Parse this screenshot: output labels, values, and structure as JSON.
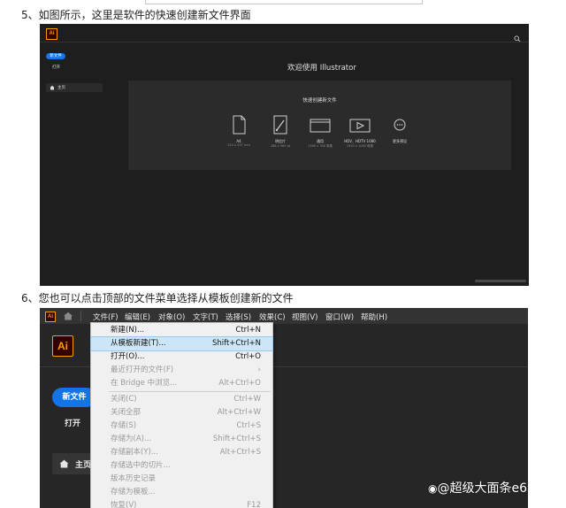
{
  "steps": {
    "step5": "5、如图所示，这里是软件的快速创建新文件界面",
    "step6": "6、您也可以点击顶部的文件菜单选择从模板创建新的文件"
  },
  "screen1": {
    "logo_text": "Ai",
    "new_file_button": "新文件",
    "open_label": "打开",
    "home_label": "主页",
    "welcome": "欢迎使用 Illustrator",
    "quick_create_title": "快速创建新文件",
    "presets": [
      {
        "name": "A4",
        "size": "210 x 297 mm",
        "icon": "document-icon"
      },
      {
        "name": "明信片",
        "size": "288 x 560 pt",
        "icon": "brush-icon"
      },
      {
        "name": "通用",
        "size": "1366 x 768 像素",
        "icon": "web-icon"
      },
      {
        "name": "HDV、HDTV 1080",
        "size": "1920 x 1080 像素",
        "icon": "video-icon"
      },
      {
        "name": "更多预设",
        "size": "",
        "icon": "more-icon"
      }
    ]
  },
  "screen2": {
    "logo_text": "Ai",
    "menubar": [
      "文件(F)",
      "编辑(E)",
      "对象(O)",
      "文字(T)",
      "选择(S)",
      "效果(C)",
      "视图(V)",
      "窗口(W)",
      "帮助(H)"
    ],
    "new_file_button": "新文件",
    "open_label": "打开",
    "home_label": "主页",
    "file_menu": [
      {
        "label": "新建(N)...",
        "shortcut": "Ctrl+N",
        "disabled": false,
        "highlight": false
      },
      {
        "label": "从模板新建(T)...",
        "shortcut": "Shift+Ctrl+N",
        "disabled": false,
        "highlight": true
      },
      {
        "label": "打开(O)...",
        "shortcut": "Ctrl+O",
        "disabled": false,
        "highlight": false
      },
      {
        "label": "最近打开的文件(F)",
        "shortcut": "",
        "disabled": true,
        "highlight": false,
        "submenu": true
      },
      {
        "label": "在 Bridge 中浏览...",
        "shortcut": "Alt+Ctrl+O",
        "disabled": true,
        "highlight": false
      },
      {
        "label": "关闭(C)",
        "shortcut": "Ctrl+W",
        "disabled": true,
        "highlight": false
      },
      {
        "label": "关闭全部",
        "shortcut": "Alt+Ctrl+W",
        "disabled": true,
        "highlight": false
      },
      {
        "label": "存储(S)",
        "shortcut": "Ctrl+S",
        "disabled": true,
        "highlight": false
      },
      {
        "label": "存储为(A)...",
        "shortcut": "Shift+Ctrl+S",
        "disabled": true,
        "highlight": false
      },
      {
        "label": "存储副本(Y)...",
        "shortcut": "Alt+Ctrl+S",
        "disabled": true,
        "highlight": false
      },
      {
        "label": "存储选中的切片...",
        "shortcut": "",
        "disabled": true,
        "highlight": false
      },
      {
        "label": "版本历史记录",
        "shortcut": "",
        "disabled": true,
        "highlight": false
      },
      {
        "label": "存储为模板...",
        "shortcut": "",
        "disabled": true,
        "highlight": false
      },
      {
        "label": "恢复(V)",
        "shortcut": "F12",
        "disabled": true,
        "highlight": false
      }
    ]
  },
  "watermark": "@超级大面条e6",
  "colors": {
    "accent": "#1473e6",
    "ai_orange": "#ff9a00",
    "ai_dark": "#330000"
  }
}
